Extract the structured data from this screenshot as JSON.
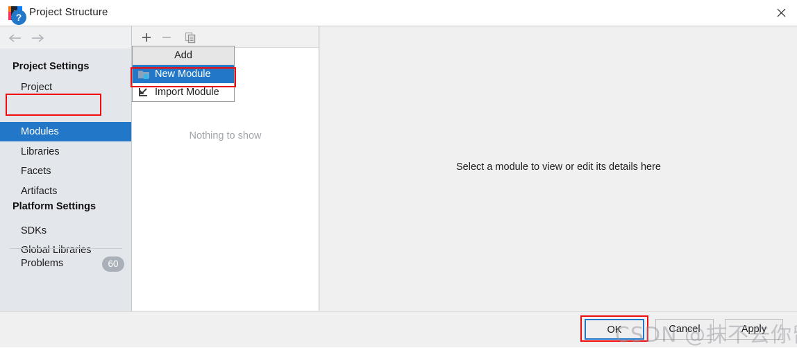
{
  "window": {
    "title": "Project Structure",
    "app_icon": "intellij-idea-icon",
    "close_label": "×"
  },
  "nav": {
    "back_icon": "←",
    "forward_icon": "→"
  },
  "sidebar": {
    "groups": [
      {
        "label": "Project Settings"
      },
      {
        "label": "Platform Settings"
      }
    ],
    "items": [
      {
        "label": "Project",
        "selected": false
      },
      {
        "label": "Modules",
        "selected": true
      },
      {
        "label": "Libraries",
        "selected": false
      },
      {
        "label": "Facets",
        "selected": false
      },
      {
        "label": "Artifacts",
        "selected": false
      },
      {
        "label": "SDKs",
        "selected": false
      },
      {
        "label": "Global Libraries",
        "selected": false
      }
    ],
    "problems": {
      "label": "Problems",
      "count": "60"
    }
  },
  "toolbar": {
    "add_icon": "+",
    "remove_icon": "−",
    "copy_icon": "copy-icon"
  },
  "midpanel": {
    "empty_text": "Nothing to show"
  },
  "rightpanel": {
    "hint_text": "Select a module to view or edit its details here"
  },
  "add_popup": {
    "header": "Add",
    "items": [
      {
        "label": "New Module",
        "icon": "new-folder-icon",
        "highlighted": true
      },
      {
        "label": "Import Module",
        "icon": "import-arrow-icon",
        "highlighted": false
      }
    ]
  },
  "footer": {
    "help_label": "?",
    "ok_label": "OK",
    "cancel_label": "Cancel",
    "apply_label": "Apply"
  },
  "watermark": {
    "text": "CSDN @抹不去你留下的唇印"
  },
  "colors": {
    "accent_blue": "#2277c8",
    "annotation_red": "#ef0c0c",
    "sidebar_bg": "#e3e7ec",
    "panel_bg": "#f0f0f0",
    "badge_gray": "#a9b0b8"
  }
}
